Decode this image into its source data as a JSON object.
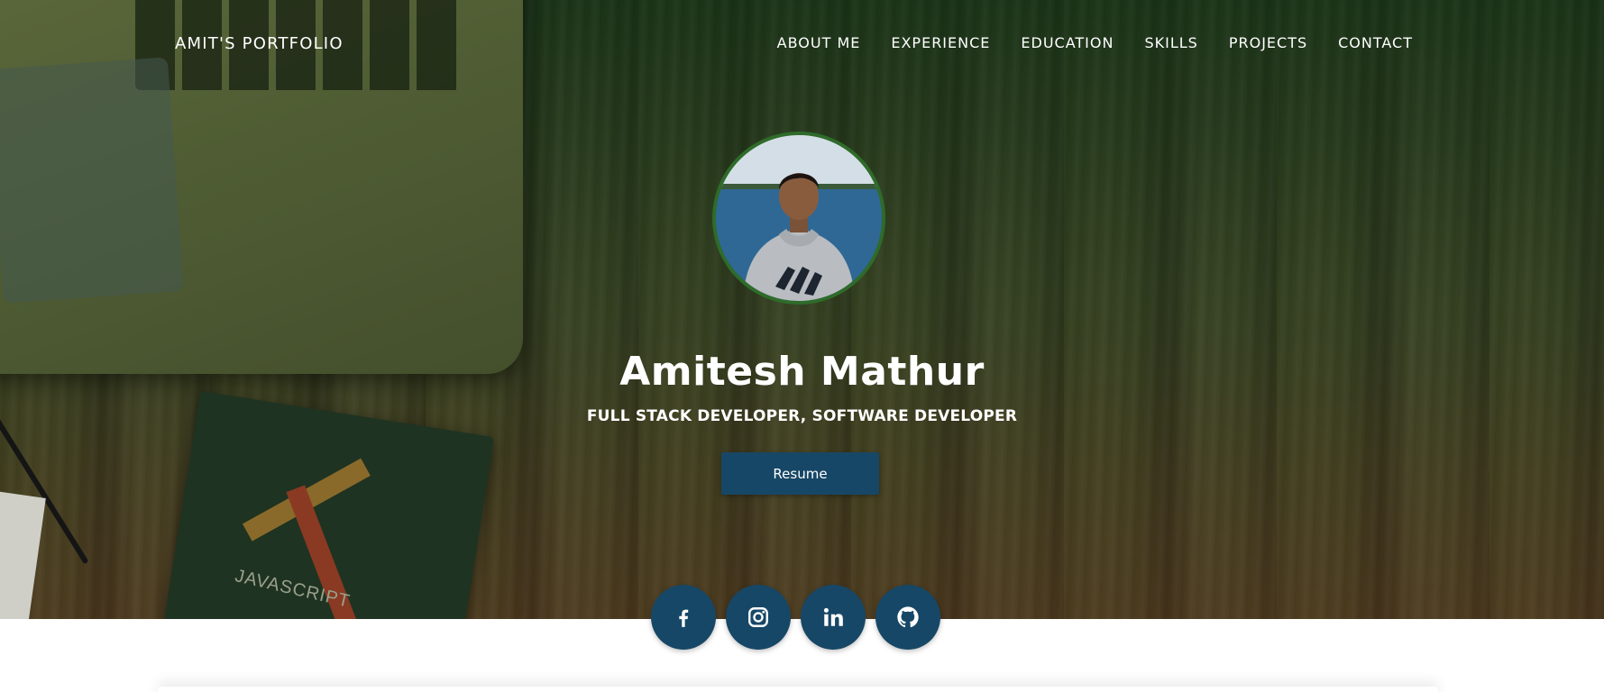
{
  "header": {
    "brand": "AMIT'S PORTFOLIO",
    "nav": [
      {
        "label": "ABOUT ME"
      },
      {
        "label": "EXPERIENCE"
      },
      {
        "label": "EDUCATION"
      },
      {
        "label": "SKILLS"
      },
      {
        "label": "PROJECTS"
      },
      {
        "label": "CONTACT"
      }
    ]
  },
  "hero": {
    "name": "Amitesh Mathur",
    "subtitle": "FULL STACK DEVELOPER, SOFTWARE DEVELOPER",
    "resume_label": "Resume",
    "book_text": "JAVASCRIPT"
  },
  "social": [
    {
      "icon": "facebook-icon"
    },
    {
      "icon": "instagram-icon"
    },
    {
      "icon": "linkedin-icon"
    },
    {
      "icon": "github-icon"
    }
  ],
  "colors": {
    "accent": "#174766",
    "avatar_border": "#2f6b2a",
    "text_on_hero": "#ffffff"
  }
}
